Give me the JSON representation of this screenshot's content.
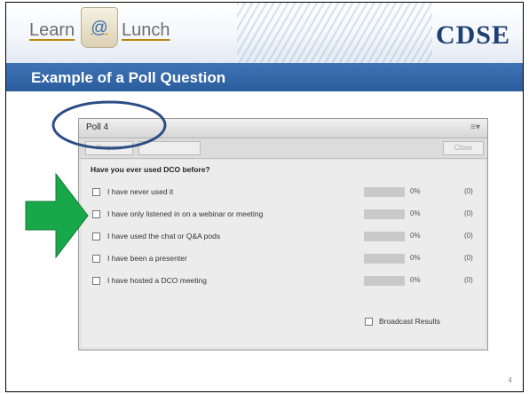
{
  "header": {
    "logo_learn": "Learn",
    "logo_at": "@",
    "logo_lunch": "Lunch",
    "logo_brand": "CDSE",
    "slide_title": "Example of a Poll Question"
  },
  "poll": {
    "title": "Poll 4",
    "menu_icon": "≡▾",
    "toolbar": {
      "prepare_label": "Prepare",
      "second_label": "",
      "close_label": "Close"
    },
    "question": "Have you ever used DCO before?",
    "options": [
      {
        "label": "I have never used it",
        "percent": "0%",
        "count": "(0)",
        "value": 0
      },
      {
        "label": "I have only listened in on a webinar or meeting",
        "percent": "0%",
        "count": "(0)",
        "value": 0
      },
      {
        "label": "I have used the chat or Q&A pods",
        "percent": "0%",
        "count": "(0)",
        "value": 0
      },
      {
        "label": "I have been a presenter",
        "percent": "0%",
        "count": "(0)",
        "value": 0
      },
      {
        "label": "I have hosted a DCO meeting",
        "percent": "0%",
        "count": "(0)",
        "value": 0
      }
    ],
    "broadcast_label": "Broadcast Results"
  },
  "slide_number": "4",
  "colors": {
    "title_bar": "#2f63a6",
    "brand_navy": "#1e3f72",
    "circle": "#2c4e85",
    "arrow_fill": "#18a84a"
  }
}
